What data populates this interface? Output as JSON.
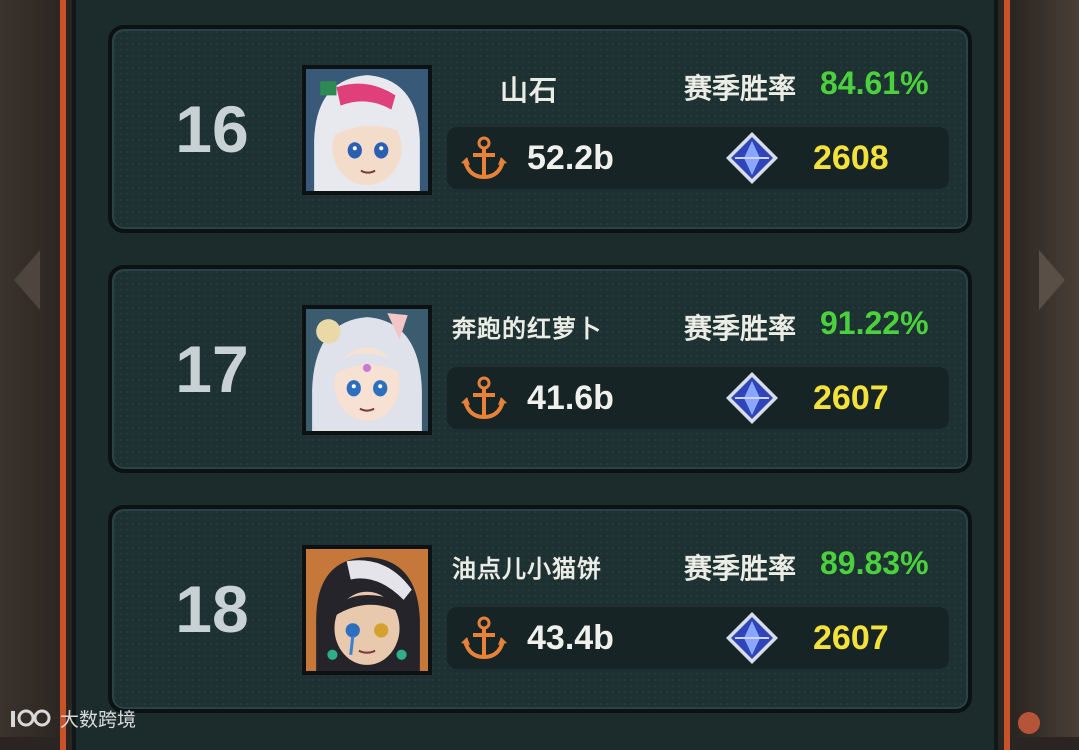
{
  "leaderboard": {
    "winrate_label": "赛季胜率",
    "rows": [
      {
        "rank": "16",
        "name": "山石",
        "winrate": "84.61%",
        "power": "52.2b",
        "score": "2608",
        "avatar_icon": "character-portrait-white-hair-pink-streak-icon"
      },
      {
        "rank": "17",
        "name": "奔跑的红萝卜",
        "winrate": "91.22%",
        "power": "41.6b",
        "score": "2607",
        "avatar_icon": "character-portrait-white-hair-flower-icon"
      },
      {
        "rank": "18",
        "name": "油点儿小猫饼",
        "winrate": "89.83%",
        "power": "43.4b",
        "score": "2607",
        "avatar_icon": "character-portrait-black-white-hair-icon"
      }
    ]
  },
  "icons": {
    "power": "anchor-icon",
    "score": "blue-crystal-icon"
  },
  "watermark": {
    "text": "大数跨境"
  },
  "colors": {
    "winrate": "#4cd13e",
    "score": "#f4e13b",
    "frame_accent": "#c8532b",
    "panel": "#1e3132"
  }
}
